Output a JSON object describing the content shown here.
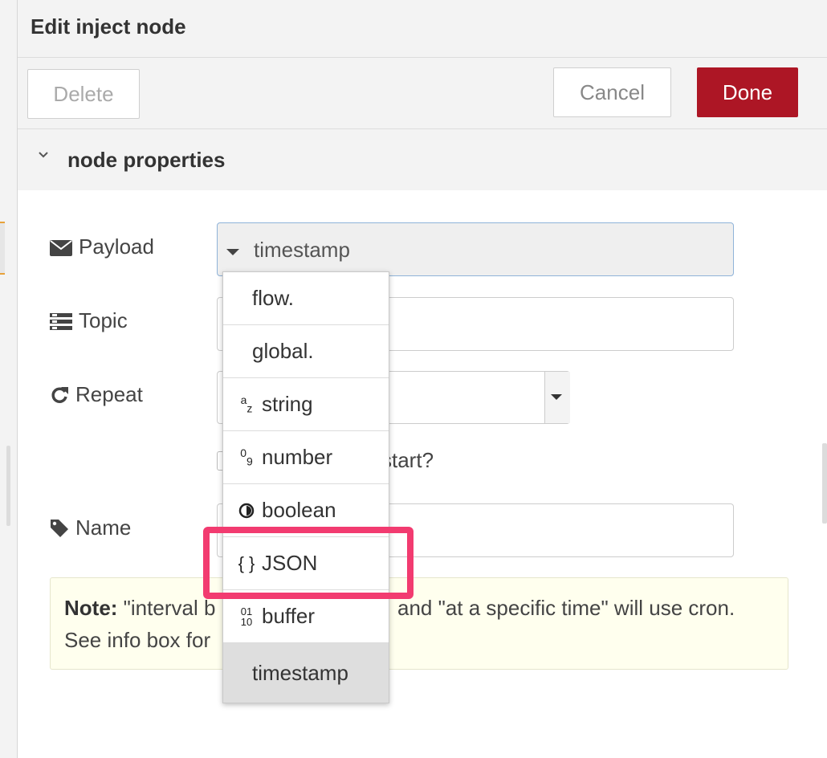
{
  "tray": {
    "title": "Edit inject node",
    "delete_label": "Delete",
    "cancel_label": "Cancel",
    "done_label": "Done",
    "section_title": "node properties"
  },
  "form": {
    "payload_label": "Payload",
    "payload_value": "timestamp",
    "topic_label": "Topic",
    "repeat_label": "Repeat",
    "start_text_partial": "start?",
    "name_label": "Name"
  },
  "note": {
    "bold": "Note:",
    "line1_left": "\"interval b",
    "line1_right": "and \"at a specific time\" will use cron.",
    "line2_left": "See info box for"
  },
  "menu": {
    "items": [
      {
        "icon": "",
        "label": "flow."
      },
      {
        "icon": "",
        "label": "global."
      },
      {
        "icon": "az-icon",
        "label": "string"
      },
      {
        "icon": "09-icon",
        "label": "number"
      },
      {
        "icon": "toggle-icon",
        "label": "boolean"
      },
      {
        "icon": "braces-icon",
        "label": "JSON"
      },
      {
        "icon": "binary-icon",
        "label": "buffer"
      },
      {
        "icon": "",
        "label": "timestamp"
      }
    ],
    "selected": "timestamp",
    "highlighted": "JSON"
  },
  "colors": {
    "done_button": "#ad1625",
    "highlight": "#f23b70",
    "note_background": "#ffffee"
  }
}
